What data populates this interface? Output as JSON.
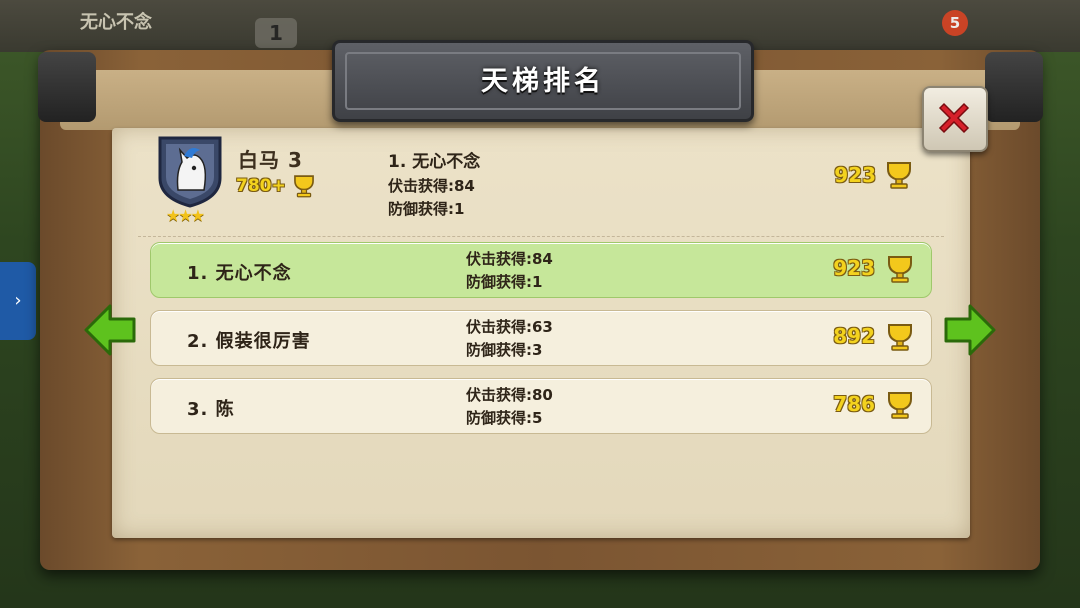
{
  "background": {
    "player_name": "无心不念",
    "top_counter": "1",
    "notification_badge": "5"
  },
  "title": "天梯排名",
  "header": {
    "player_name": "白马 3",
    "player_trophies": "780+",
    "stars": 3,
    "top_rank": "1. 无心不念",
    "attack_gain": "伏击获得:84",
    "defense_gain": "防御获得:1",
    "top_score": "923"
  },
  "rankings": [
    {
      "rank_label": "1. 无心不念",
      "attack": "伏击获得:84",
      "defense": "防御获得:1",
      "score": "923",
      "highlighted": true
    },
    {
      "rank_label": "2. 假装很厉害",
      "attack": "伏击获得:63",
      "defense": "防御获得:3",
      "score": "892",
      "highlighted": false
    },
    {
      "rank_label": "3. 陈",
      "attack": "伏击获得:80",
      "defense": "防御获得:5",
      "score": "786",
      "highlighted": false
    }
  ],
  "icons": {
    "close": "close-x-icon",
    "prev": "arrow-left-icon",
    "next": "arrow-right-icon",
    "trophy": "trophy-cup-icon",
    "avatar": "white-horse-shield-icon",
    "star": "star-icon"
  },
  "colors": {
    "highlight_row": "#c6e79a",
    "trophy_text": "#f3d21e",
    "arrow_green": "#5ec21e",
    "close_red": "#d6202a"
  }
}
